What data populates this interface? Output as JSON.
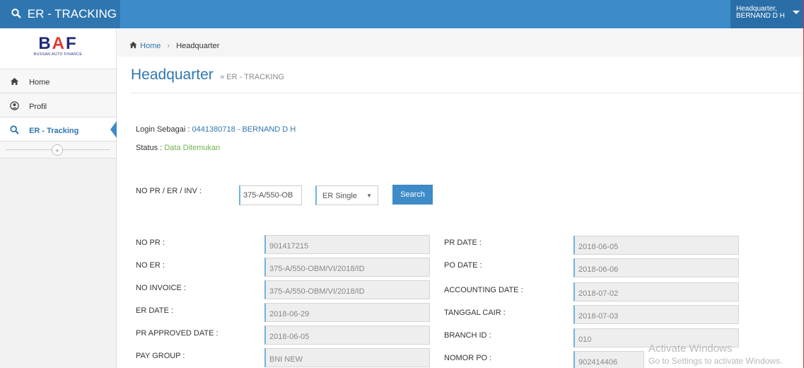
{
  "app": {
    "title": "ER - TRACKING",
    "user_line1": "Headquarter,",
    "user_line2": "BERNAND D H"
  },
  "logo": {
    "text_a": "B",
    "text_tri": "A",
    "text_b": "F",
    "subtitle": "BUSSAN AUTO FINANCE"
  },
  "sidebar": {
    "items": [
      {
        "label": "Home",
        "icon": "home-icon"
      },
      {
        "label": "Profil",
        "icon": "user-circle-icon"
      },
      {
        "label": "ER - Tracking",
        "icon": "search-icon"
      }
    ],
    "collapse_glyph": "«"
  },
  "breadcrumb": {
    "home": "Home",
    "current": "Headquarter"
  },
  "page": {
    "title": "Headquarter",
    "subtitle": "» ER - TRACKING"
  },
  "info": {
    "login_label": "Login Sebagai : ",
    "login_value": "0441380718 - BERNAND D H",
    "status_label": "Status : ",
    "status_value": "Data Ditemukan"
  },
  "search": {
    "label": "NO PR / ER / INV :",
    "input_value": "375-A/550-OB",
    "select_value": "ER Single",
    "button_label": "Search"
  },
  "fields_left": [
    {
      "label": "NO PR :",
      "value": "901417215"
    },
    {
      "label": "NO ER :",
      "value": "375-A/550-OBM/VI/2018/ID"
    },
    {
      "label": "NO INVOICE :",
      "value": "375-A/550-OBM/VI/2018/ID"
    },
    {
      "label": "ER DATE :",
      "value": "2018-06-29"
    },
    {
      "label": "PR APPROVED DATE :",
      "value": "2018-06-05"
    },
    {
      "label": "PAY GROUP :",
      "value": "BNI NEW"
    }
  ],
  "fields_right": [
    {
      "label": "PR DATE :",
      "value": "2018-06-05"
    },
    {
      "label": "PO DATE :",
      "value": "2018-06-06"
    },
    {
      "label": "ACCOUNTING DATE :",
      "value": "2018-07-02"
    },
    {
      "label": "TANGGAL CAIR :",
      "value": "2018-07-03"
    },
    {
      "label": "BRANCH ID :",
      "value": "010"
    },
    {
      "label": "NOMOR PO :",
      "value": "902414406"
    }
  ],
  "watermark": {
    "line1": "Activate Windows",
    "line2": "Go to Settings to activate Windows."
  }
}
